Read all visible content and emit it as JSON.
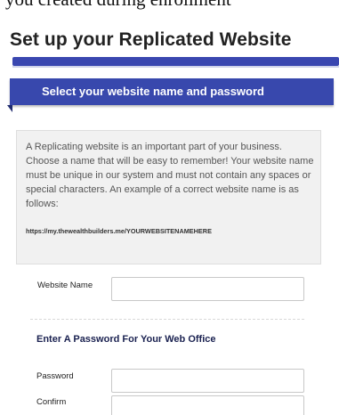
{
  "caption": "you created during enrollment",
  "page": {
    "title": "Set up your Replicated Website",
    "banner": "Select your website name and password"
  },
  "info": {
    "text": "A Replicating website is an important part of your business. Choose a name that will be easy to remember! Your website name must be unique in our system and must not contain any spaces or special characters. An example of a correct website name is as follows:",
    "example_url": "https://my.thewealthbuilders.me/YOURWEBSITENAMEHERE"
  },
  "form": {
    "website_name_label": "Website Name",
    "website_name_value": "",
    "password_section_heading": "Enter A Password For Your Web Office",
    "password_label": "Password",
    "password_value": "",
    "confirm_label": "Confirm",
    "confirm_value": ""
  },
  "colors": {
    "accent": "#3848ad",
    "heading": "#1a2150"
  }
}
